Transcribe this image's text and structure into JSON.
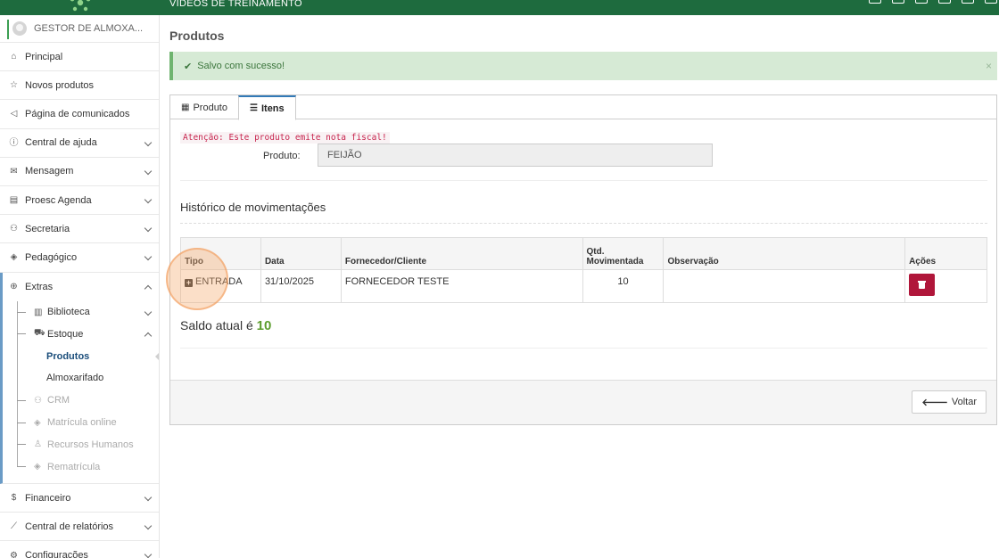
{
  "header": {
    "title": "VÍDEOS DE TREINAMENTO"
  },
  "sidebar": {
    "user": "GESTOR DE ALMOXA...",
    "items": [
      {
        "label": "Principal",
        "icon": "home-icon"
      },
      {
        "label": "Novos produtos",
        "icon": "star-icon"
      },
      {
        "label": "Página de comunicados",
        "icon": "megaphone-icon"
      },
      {
        "label": "Central de ajuda",
        "icon": "info-icon"
      },
      {
        "label": "Mensagem",
        "icon": "envelope-icon"
      },
      {
        "label": "Proesc Agenda",
        "icon": "agenda-icon"
      },
      {
        "label": "Secretaria",
        "icon": "users-icon"
      },
      {
        "label": "Pedagógico",
        "icon": "graduation-cap-icon"
      }
    ],
    "extras": {
      "label": "Extras",
      "icon": "plus-circle-icon",
      "children": [
        {
          "label": "Biblioteca",
          "icon": "book-icon"
        },
        {
          "label": "Estoque",
          "icon": "truck-icon"
        }
      ],
      "estoque_children": [
        {
          "label": "Produtos",
          "active": true
        },
        {
          "label": "Almoxarifado",
          "active": false
        }
      ],
      "more": [
        {
          "label": "CRM",
          "icon": "users-icon"
        },
        {
          "label": "Matrícula online",
          "icon": "graduation-cap-icon"
        },
        {
          "label": "Recursos Humanos",
          "icon": "person-icon"
        },
        {
          "label": "Rematrícula",
          "icon": "graduation-cap-icon"
        }
      ]
    },
    "bottom_items": [
      {
        "label": "Financeiro",
        "icon": "money-icon"
      },
      {
        "label": "Central de relatórios",
        "icon": "chart-icon"
      },
      {
        "label": "Configurações",
        "icon": "gear-icon"
      }
    ]
  },
  "page": {
    "title": "Produtos",
    "alert": "Salvo com sucesso!",
    "alert_close": "×",
    "tabs": [
      {
        "label": "Produto",
        "active": false
      },
      {
        "label": "Itens",
        "active": true
      }
    ],
    "notice": "Atenção: Este produto emite nota fiscal!",
    "product_label": "Produto:",
    "product_value": "FEIJÃO",
    "history_title": "Histórico de movimentações",
    "table": {
      "headers": [
        "Tipo",
        "Data",
        "Fornecedor/Cliente",
        "Qtd. Movimentada",
        "Observação",
        "Ações"
      ],
      "rows": [
        {
          "tipo": "ENTRADA",
          "data": "31/10/2025",
          "fornecedor": "FORNECEDOR TESTE",
          "qtd": "10",
          "obs": ""
        }
      ]
    },
    "saldo_text": "Saldo atual é",
    "saldo_value": "10",
    "back_label": "Voltar"
  },
  "colors": {
    "topbar": "#1e6b3e",
    "alert_bg": "#d6ead5",
    "delete_button": "#b0163a",
    "saldo_value": "#5c9d2e"
  }
}
